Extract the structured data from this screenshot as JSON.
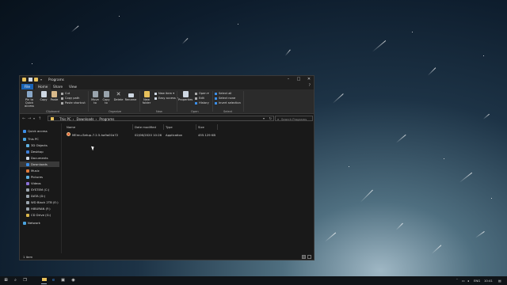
{
  "window": {
    "title": "Programs",
    "tabs": [
      "File",
      "Home",
      "Share",
      "View"
    ],
    "active_tab": "Home"
  },
  "ribbon": {
    "clipboard": {
      "label": "Clipboard",
      "pin": "Pin to Quick access",
      "copy": "Copy",
      "paste": "Paste",
      "cut": "Cut",
      "copy_path": "Copy path",
      "paste_shortcut": "Paste shortcut"
    },
    "organize": {
      "label": "Organize",
      "move_to": "Move to",
      "copy_to": "Copy to",
      "delete": "Delete",
      "rename": "Rename"
    },
    "new": {
      "label": "New",
      "new_folder": "New folder",
      "new_item": "New item",
      "easy_access": "Easy access"
    },
    "open": {
      "label": "Open",
      "properties": "Properties",
      "open": "Open",
      "edit": "Edit",
      "history": "History"
    },
    "select": {
      "label": "Select",
      "select_all": "Select all",
      "select_none": "Select none",
      "invert_selection": "Invert selection"
    }
  },
  "address": {
    "breadcrumb": [
      "This PC",
      "Downloads",
      "Programs"
    ],
    "search_placeholder": "Search Programs"
  },
  "nav_pane": {
    "items": [
      {
        "label": "Quick access",
        "color": "#3b8ee8"
      },
      {
        "label": "This PC",
        "color": "#4aa3df"
      },
      {
        "label": "3D Objects",
        "color": "#5fb0e0"
      },
      {
        "label": "Desktop",
        "color": "#3d7dd6"
      },
      {
        "label": "Documents",
        "color": "#cfd8e3"
      },
      {
        "label": "Downloads",
        "color": "#3b8ee8"
      },
      {
        "label": "Music",
        "color": "#e07b3b"
      },
      {
        "label": "Pictures",
        "color": "#5fb0e0"
      },
      {
        "label": "Videos",
        "color": "#8a6fd6"
      },
      {
        "label": "SYSTEM (C:)",
        "color": "#9aa4ad"
      },
      {
        "label": "DATA (D:)",
        "color": "#9aa4ad"
      },
      {
        "label": "WD Black 2TB (E:)",
        "color": "#9aa4ad"
      },
      {
        "label": "HIBURAN (F:)",
        "color": "#9aa4ad"
      },
      {
        "label": "CD Drive (G:)",
        "color": "#d9b54a"
      },
      {
        "label": "Network",
        "color": "#4aa3df"
      }
    ],
    "selected": "Downloads"
  },
  "columns": [
    "Name",
    "Date modified",
    "Type",
    "Size"
  ],
  "files": [
    {
      "name": "MEmu-Setup-7.2.5-ha9a01b72",
      "date": "02/06/2020 10:26",
      "type": "Application",
      "size": "455.129 KB"
    }
  ],
  "status": {
    "count": "1 item"
  },
  "taskbar": {
    "language": "ENG",
    "time": "10:41"
  }
}
